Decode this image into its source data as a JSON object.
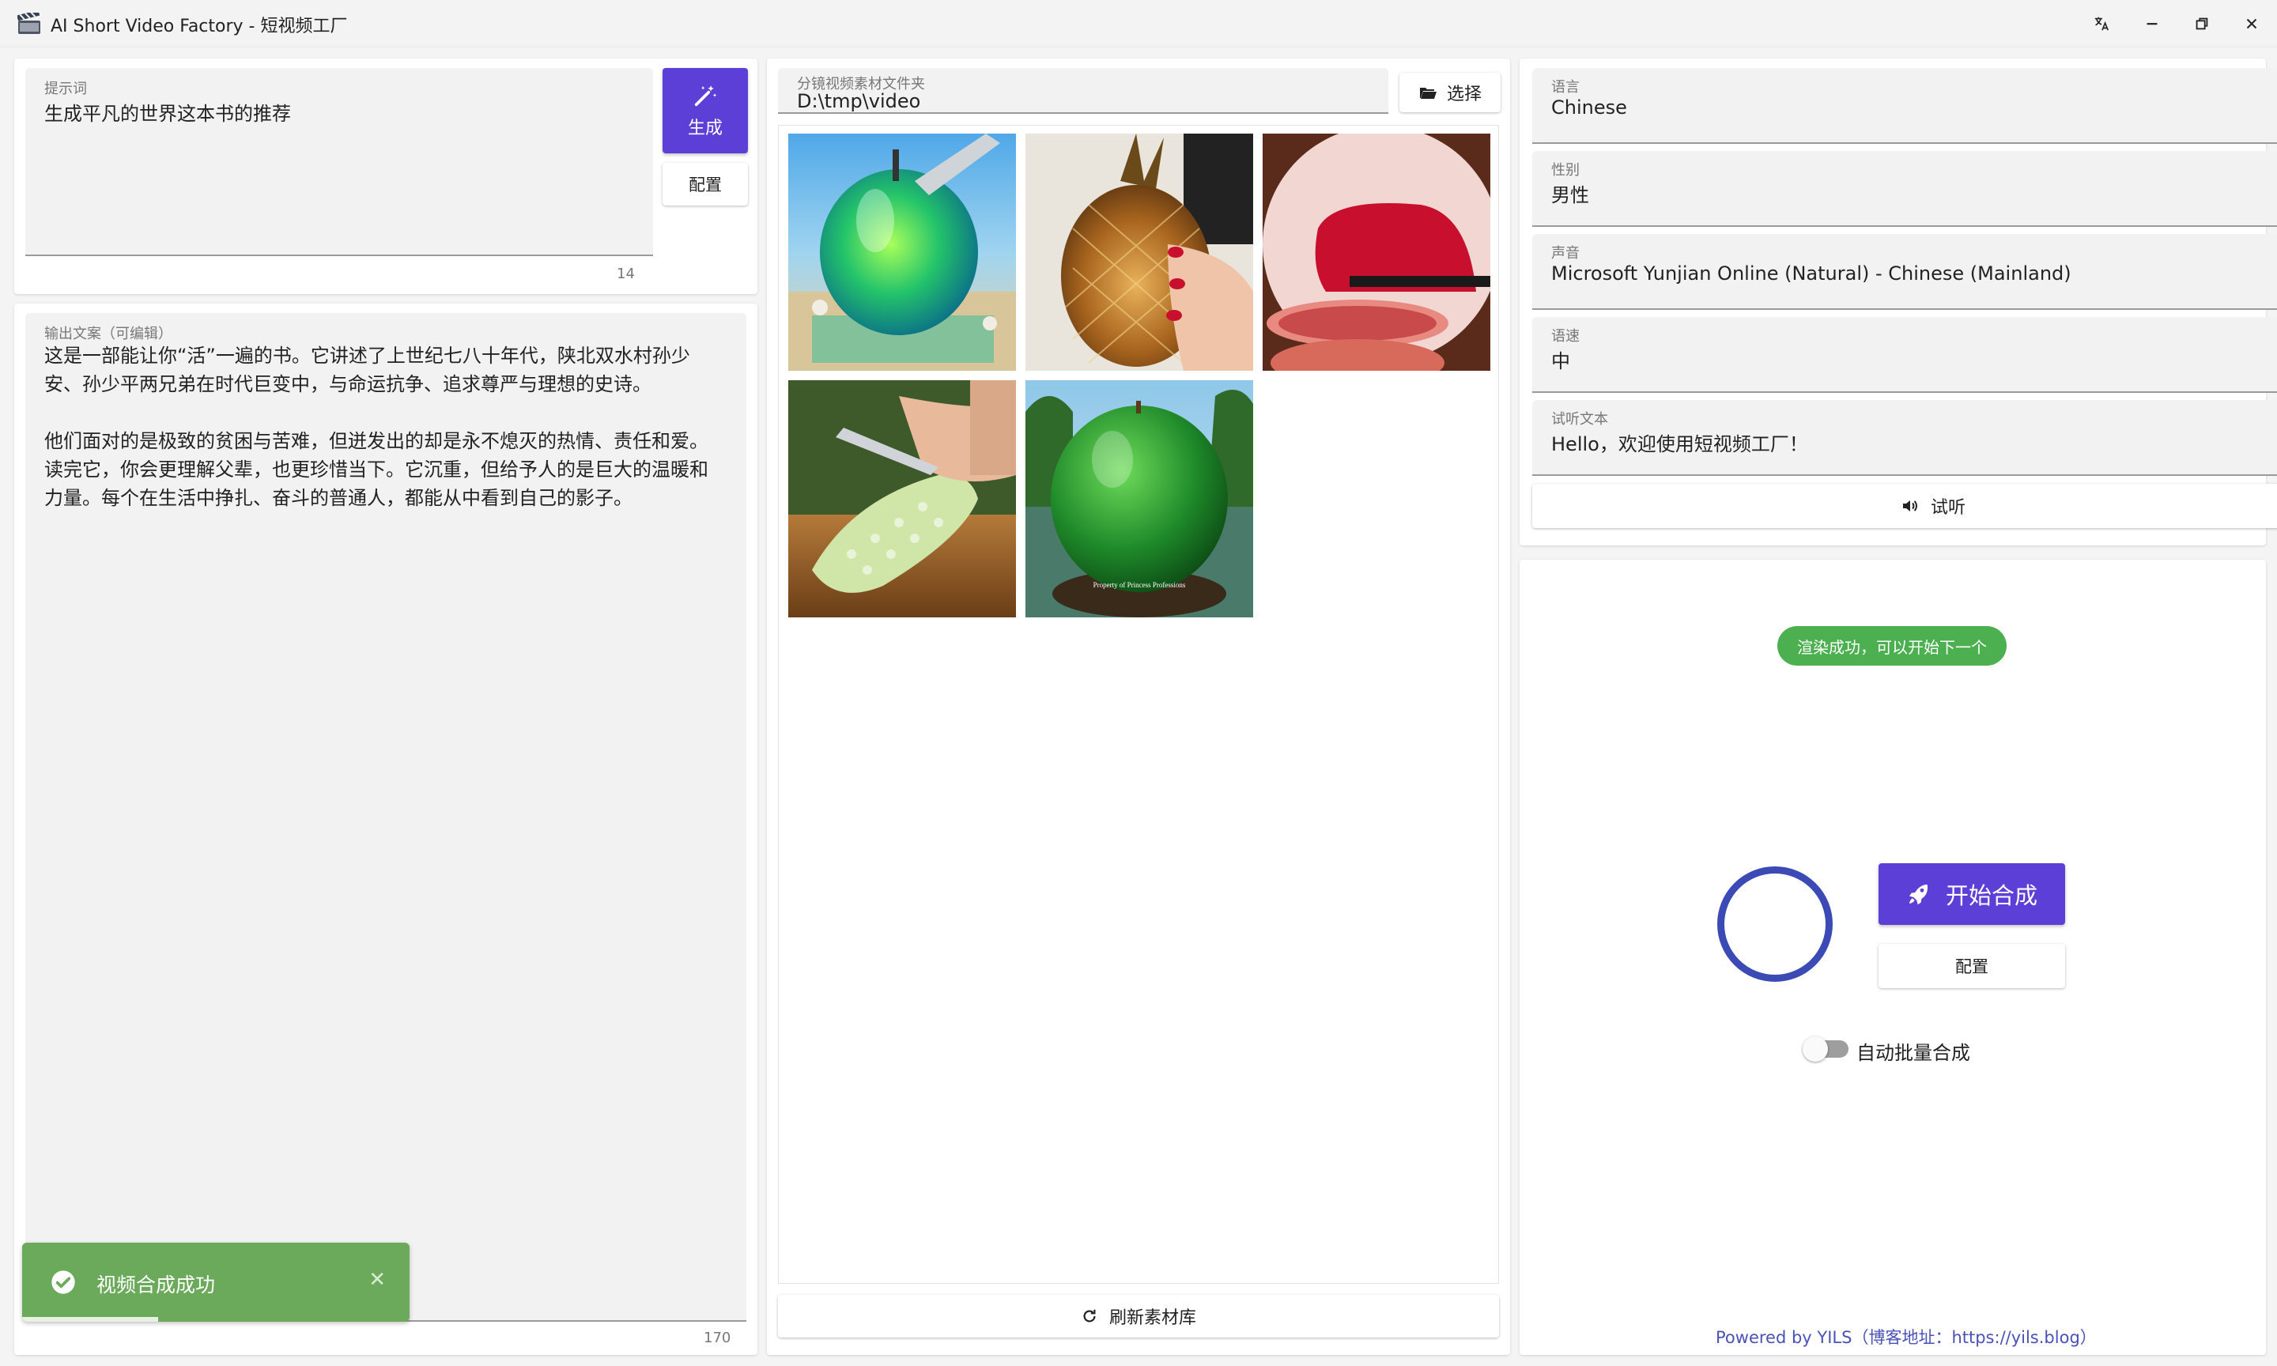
{
  "window": {
    "title": "AI Short Video Factory - 短视频工厂"
  },
  "prompt_panel": {
    "label": "提示词",
    "value": "生成平凡的世界这本书的推荐",
    "counter": "14",
    "generate_label": "生成",
    "config_label": "配置"
  },
  "output_panel": {
    "label": "输出文案（可编辑）",
    "text": "这是一部能让你“活”一遍的书。它讲述了上世纪七八十年代，陕北双水村孙少\n安、孙少平两兄弟在时代巨变中，与命运抗争、追求尊严与理想的史诗。\n\n他们面对的是极致的贫困与苦难，但迸发出的却是永不熄灭的热情、责任和爱。\n读完它，你会更理解父辈，也更珍惜当下。它沉重，但给予人的是巨大的温暖和\n力量。每个在生活中挣扎、奋斗的普通人，都能从中看到自己的影子。",
    "counter": "170"
  },
  "material_panel": {
    "label": "分镜视频素材文件夹",
    "path": "D:\\tmp\\video",
    "select_label": "选择",
    "refresh_label": "刷新素材库",
    "thumbnails": [
      {
        "name": "glass-apple-thumbnail"
      },
      {
        "name": "glass-pineapple-thumbnail"
      },
      {
        "name": "red-fruit-thumbnail"
      },
      {
        "name": "glass-cucumber-thumbnail"
      },
      {
        "name": "green-sphere-thumbnail",
        "caption": "Property of Princess Professions"
      }
    ]
  },
  "voice_panel": {
    "language": {
      "label": "语言",
      "value": "Chinese"
    },
    "gender": {
      "label": "性别",
      "value": "男性"
    },
    "voice": {
      "label": "声音",
      "value": "Microsoft Yunjian Online (Natural) - Chinese (Mainland)"
    },
    "speed": {
      "label": "语速",
      "value": "中"
    },
    "sample": {
      "label": "试听文本",
      "value": "Hello，欢迎使用短视频工厂！"
    },
    "listen_label": "试听"
  },
  "render_panel": {
    "status_chip": "渲染成功，可以开始下一个",
    "start_label": "开始合成",
    "config_label": "配置",
    "auto_batch_label": "自动批量合成",
    "auto_batch_on": false,
    "footer": "Powered by YILS（博客地址：https://yils.blog）"
  },
  "toast": {
    "message": "视频合成成功",
    "progress": 0.35
  },
  "colors": {
    "primary": "#5b3fd6",
    "success": "#4caf50",
    "toast": "#6aaa5a",
    "spinner": "#3b4ab5",
    "link": "#4a52b8"
  }
}
